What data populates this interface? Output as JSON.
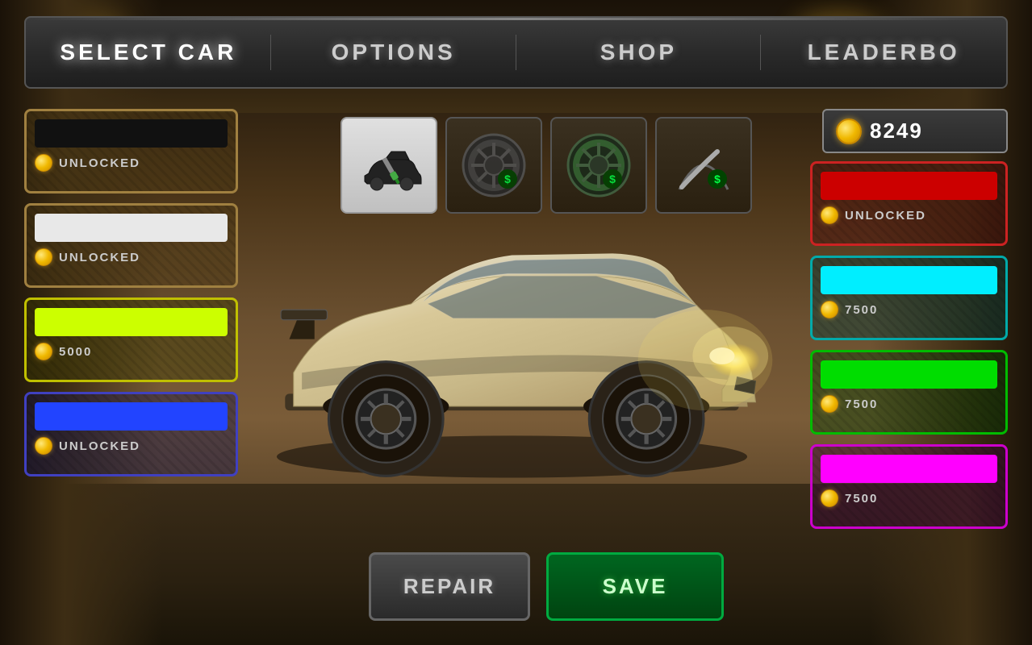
{
  "nav": {
    "items": [
      {
        "id": "select-car",
        "label": "SELECT CAR",
        "active": true
      },
      {
        "id": "options",
        "label": "OPTIONS",
        "active": false
      },
      {
        "id": "shop",
        "label": "SHOP",
        "active": false
      },
      {
        "id": "leaderboard",
        "label": "LEADERBO",
        "active": false
      }
    ]
  },
  "currency": {
    "amount": "8249",
    "icon": "coin"
  },
  "left_swatches": [
    {
      "id": "black",
      "color": "#111111",
      "status": "UNLOCKED",
      "borderColor": "#a08040",
      "locked": false
    },
    {
      "id": "white",
      "color": "#e8e8e8",
      "status": "UNLOCKED",
      "borderColor": "#a08040",
      "locked": false
    },
    {
      "id": "yellow",
      "color": "#ccff00",
      "status": "5000",
      "borderColor": "#c0c000",
      "locked": true
    },
    {
      "id": "blue",
      "color": "#2244ff",
      "status": "UNLOCKED",
      "borderColor": "#4040c0",
      "locked": false
    }
  ],
  "right_swatches": [
    {
      "id": "red",
      "color": "#cc0000",
      "status": "UNLOCKED",
      "borderColor": "#cc2222",
      "locked": false
    },
    {
      "id": "cyan",
      "color": "#00eeff",
      "status": "7500",
      "borderColor": "#00aaaa",
      "locked": true
    },
    {
      "id": "green",
      "color": "#00dd00",
      "status": "7500",
      "borderColor": "#00bb00",
      "locked": true
    },
    {
      "id": "pink",
      "color": "#ff00ff",
      "status": "7500",
      "borderColor": "#cc00cc",
      "locked": true
    }
  ],
  "custom_icons": [
    {
      "id": "paint",
      "type": "paint",
      "active": true
    },
    {
      "id": "wheel1",
      "type": "wheel-dark",
      "active": false
    },
    {
      "id": "wheel2",
      "type": "wheel-green",
      "active": false
    },
    {
      "id": "wiper",
      "type": "wiper",
      "active": false
    }
  ],
  "buttons": {
    "repair": "REPAIR",
    "save": "SAVE"
  }
}
